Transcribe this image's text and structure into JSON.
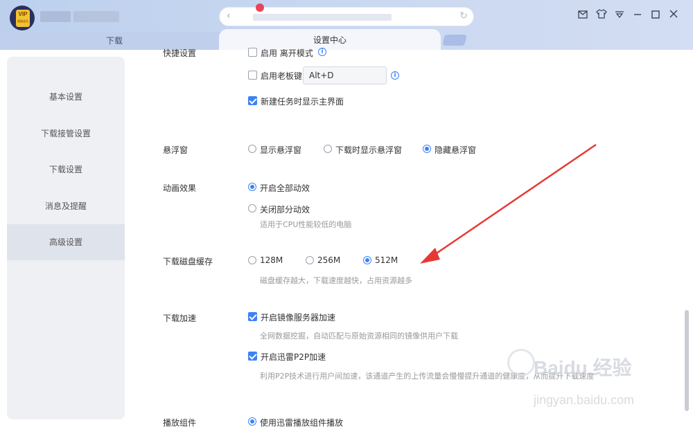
{
  "app": {
    "vip_badge": "VIP",
    "vip_sub": "超级会员"
  },
  "tabs": {
    "download": "下载",
    "settings": "设置中心"
  },
  "sidebar": {
    "items": [
      {
        "label": "基本设置"
      },
      {
        "label": "下载接管设置"
      },
      {
        "label": "下载设置"
      },
      {
        "label": "消息及提醒"
      },
      {
        "label": "高级设置"
      }
    ],
    "active_index": 4
  },
  "sections": {
    "shortcut": {
      "label": "快捷设置",
      "opt_boss_mode": "启用 离开模式",
      "opt_boss_key": "启用老板键",
      "boss_key_value": "Alt+D",
      "opt_show_main": "新建任务时显示主界面",
      "show_main_checked": true
    },
    "float_window": {
      "label": "悬浮窗",
      "options": [
        "显示悬浮窗",
        "下载时显示悬浮窗",
        "隐藏悬浮窗"
      ],
      "selected": "隐藏悬浮窗"
    },
    "animation": {
      "label": "动画效果",
      "opt_all": "开启全部动效",
      "opt_partial": "关闭部分动效",
      "partial_hint": "适用于CPU性能较低的电脑",
      "selected": "开启全部动效"
    },
    "disk_cache": {
      "label": "下载磁盘缓存",
      "options": [
        "128M",
        "256M",
        "512M"
      ],
      "selected": "512M",
      "hint": "磁盘缓存越大，下载速度越快，占用资源越多"
    },
    "acceleration": {
      "label": "下载加速",
      "opt_mirror": "开启镜像服务器加速",
      "mirror_hint": "全网数据挖掘，自动匹配与原始资源相同的镜像供用户下载",
      "opt_p2p": "开启迅雷P2P加速",
      "p2p_hint": "利用P2P技术进行用户间加速，该通道产生的上传流量会慢慢提升通道的健康度，从而提升下载速度"
    },
    "player": {
      "label": "播放组件",
      "opt_use_player": "使用迅雷播放组件播放"
    }
  },
  "watermark": {
    "line1": "Baidu 经验",
    "line2": "jingyan.baidu.com"
  },
  "colors": {
    "accent": "#3b82f6",
    "annotation_arrow": "#e53935"
  }
}
